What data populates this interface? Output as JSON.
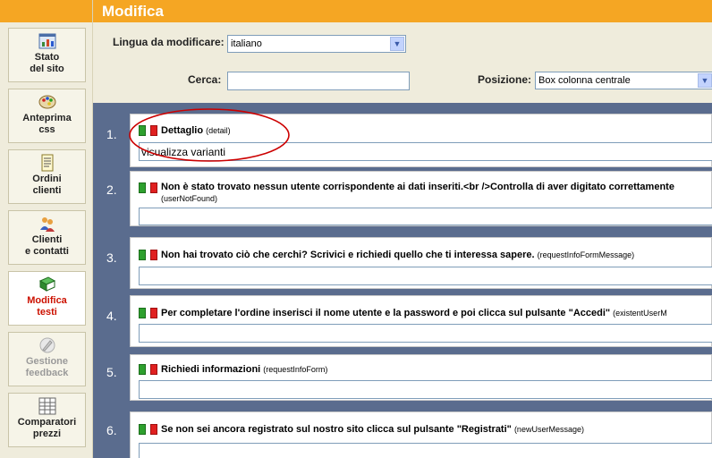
{
  "header": {
    "title": "Modifica"
  },
  "sidebar": {
    "items": [
      {
        "label1": "Stato",
        "label2": "del sito",
        "icon": "chart-window-icon"
      },
      {
        "label1": "Anteprima",
        "label2": "css",
        "icon": "palette-icon"
      },
      {
        "label1": "Ordini",
        "label2": "clienti",
        "icon": "document-icon"
      },
      {
        "label1": "Clienti",
        "label2": "e contatti",
        "icon": "users-icon"
      },
      {
        "label1": "Modifica",
        "label2": "testi",
        "icon": "book-icon"
      },
      {
        "label1": "Gestione",
        "label2": "feedback",
        "icon": "pen-icon"
      },
      {
        "label1": "Comparatori",
        "label2": "prezzi",
        "icon": "table-icon"
      }
    ]
  },
  "filters": {
    "language_label": "Lingua da modificare:",
    "language_value": "italiano",
    "search_label": "Cerca:",
    "search_value": "",
    "position_label": "Posizione:",
    "position_value": "Box colonna centrale"
  },
  "entries": [
    {
      "num": "1.",
      "title": "Dettaglio",
      "key": "(detail)",
      "value": "visualizza varianti"
    },
    {
      "num": "2.",
      "title": "Non è stato trovato nessun utente corrispondente ai dati inseriti.<br />Controlla di aver digitato correttamente",
      "key": "(userNotFound)",
      "value": ""
    },
    {
      "num": "3.",
      "title": "Non hai trovato ciò che cerchi? Scrivici e richiedi quello che ti interessa sapere.",
      "key": "(requestInfoFormMessage)",
      "value": ""
    },
    {
      "num": "4.",
      "title": "Per completare l'ordine inserisci il nome utente e la password e poi clicca sul pulsante \"Accedi\"",
      "key": "(existentUserM",
      "value": ""
    },
    {
      "num": "5.",
      "title": "Richiedi informazioni",
      "key": "(requestInfoForm)",
      "value": ""
    },
    {
      "num": "6.",
      "title": "Se non sei ancora registrato sul nostro sito clicca sul pulsante \"Registrati\"",
      "key": "(newUserMessage)",
      "value": ""
    }
  ],
  "colors": {
    "header_bg": "#f5a623",
    "panel_bg": "#efecdc",
    "list_bg": "#5a6c8e",
    "active_label": "#cc1100",
    "annotation": "#cc0000"
  }
}
